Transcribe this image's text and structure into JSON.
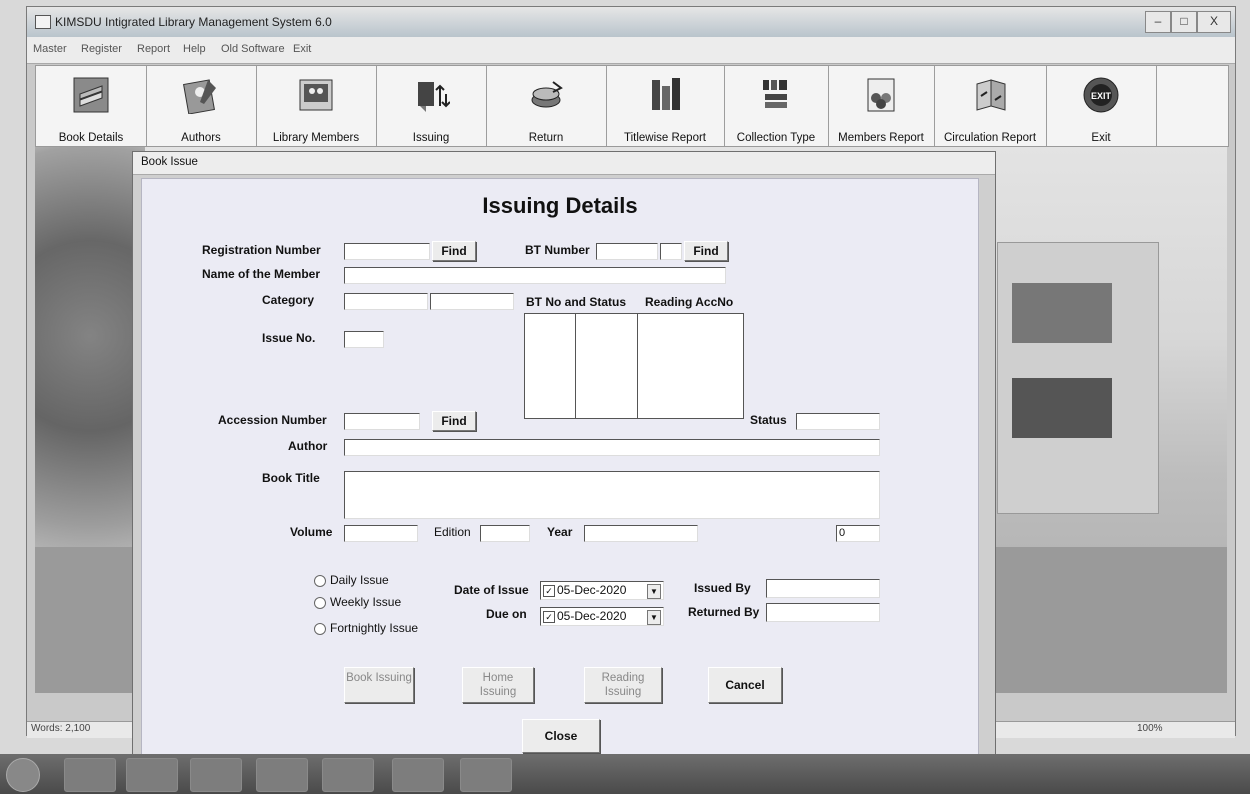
{
  "window": {
    "title": "KIMSDU Intigrated Library Management System 6.0",
    "minimize": "–",
    "maximize": "□",
    "close": "X"
  },
  "menu": [
    "Master",
    "Register",
    "Report",
    "Help",
    "Old Software",
    "Exit"
  ],
  "toolbar": [
    {
      "label": "Book Details",
      "icon": "books-icon"
    },
    {
      "label": "Authors",
      "icon": "author-icon"
    },
    {
      "label": "Library Members",
      "icon": "members-icon"
    },
    {
      "label": "Issuing",
      "icon": "issuing-icon"
    },
    {
      "label": "Return",
      "icon": "return-icon"
    },
    {
      "label": "Titlewise Report",
      "icon": "report-icon"
    },
    {
      "label": "Collection Type",
      "icon": "collection-icon"
    },
    {
      "label": "Members Report",
      "icon": "members-report-icon"
    },
    {
      "label": "Circulation Report",
      "icon": "circulation-icon"
    },
    {
      "label": "Exit",
      "icon": "exit-icon"
    }
  ],
  "exit_badge": "EXIT",
  "status": {
    "words": "Words: 2,100",
    "zoom": "100%"
  },
  "dialog": {
    "title": "Book Issue",
    "heading": "Issuing Details",
    "labels": {
      "registration_number": "Registration Number",
      "bt_number": "BT Number",
      "name_of_member": "Name of the Member",
      "category": "Category",
      "bt_no_status": "BT No and Status",
      "reading_accno": "Reading AccNo",
      "issue_no": "Issue No.",
      "accession_number": "Accession Number",
      "status": "Status",
      "author": "Author",
      "book_title": "Book Title",
      "volume": "Volume",
      "edition": "Edition",
      "year": "Year",
      "date_of_issue": "Date of Issue",
      "due_on": "Due on",
      "issued_by": "Issued By",
      "returned_by": "Returned By"
    },
    "find_label": "Find",
    "counter_value": "0",
    "radio": [
      "Daily Issue",
      "Weekly Issue",
      "Fortnightly Issue"
    ],
    "date_of_issue_value": "05-Dec-2020",
    "due_on_value": "05-Dec-2020",
    "check_mark": "✓",
    "dropdown_arrow": "▼",
    "buttons": {
      "book_issuing": "Book Issuing",
      "home_issuing": "Home Issuing",
      "reading_issuing": "Reading Issuing",
      "cancel": "Cancel",
      "close": "Close"
    }
  },
  "colors": {
    "dialog_bg": "#ebebf4",
    "toolbar_bg": "#f4f4f4"
  }
}
